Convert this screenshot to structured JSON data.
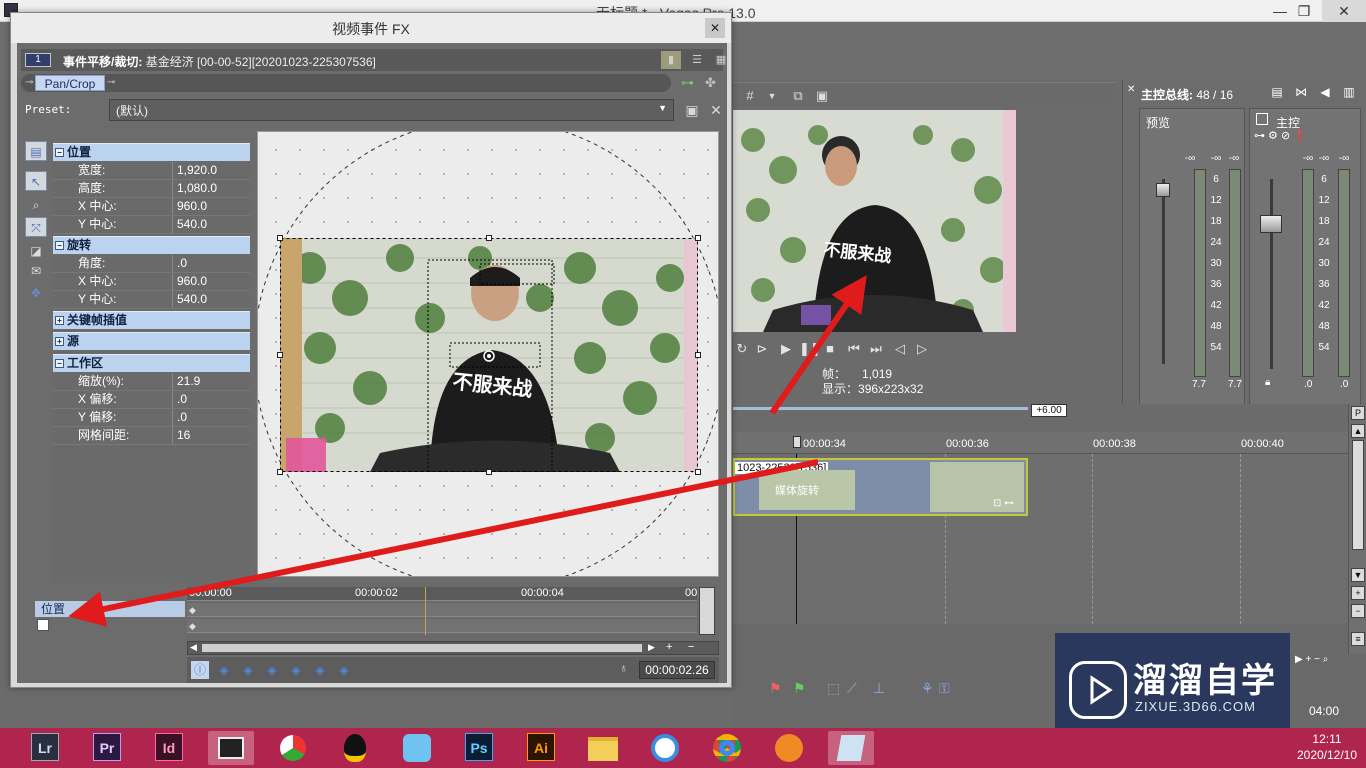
{
  "vegas": {
    "title": "无标题 * - Vegas Pro 13.0",
    "win_minimize": "—",
    "win_restore": "❐",
    "win_close": "✕",
    "preview": {
      "frame_label": "帧：",
      "frame_value": "1,019",
      "display_label": "显示：",
      "display_value": "396x223x32"
    },
    "master": {
      "title": "主控总线:",
      "count": "48 / 16",
      "preview_label": "预览",
      "main_label": "主控",
      "scale": [
        "-∞",
        "6",
        "12",
        "18",
        "24",
        "30",
        "36",
        "42",
        "48",
        "54"
      ],
      "preview_vals": [
        "7.7",
        "7.7"
      ],
      "main_vals": [
        ".0",
        ".0"
      ]
    },
    "timeline": {
      "rate_badge": "+6.00",
      "ticks": [
        "00:00:34",
        "00:00:36",
        "00:00:38",
        "00:00:40"
      ],
      "clip_name": "1023-22530[7536]",
      "clip_fx_label": "媒体旋转",
      "bottom_time": "04:00"
    }
  },
  "fx": {
    "title": "视频事件 FX",
    "close": "✕",
    "chain_badge": "1",
    "chain_title_bold": "事件平移/裁切:",
    "chain_title": "基金经济 [00-00-52][20201023-225307536]",
    "plugin_tab": "Pan/Crop",
    "preset_label": "Preset:",
    "preset_value": "(默认)",
    "sections": {
      "position": "位置",
      "rotation": "旋转",
      "keyframe_interp": "关键帧插值",
      "source": "源",
      "workspace": "工作区"
    },
    "props": {
      "width": {
        "name": "宽度:",
        "value": "1,920.0"
      },
      "height": {
        "name": "高度:",
        "value": "1,080.0"
      },
      "x_center": {
        "name": "X 中心:",
        "value": "960.0"
      },
      "y_center": {
        "name": "Y 中心:",
        "value": "540.0"
      },
      "angle": {
        "name": "角度:",
        "value": ".0"
      },
      "rot_x_center": {
        "name": "X 中心:",
        "value": "960.0"
      },
      "rot_y_center": {
        "name": "Y 中心:",
        "value": "540.0"
      },
      "zoom": {
        "name": "缩放(%):",
        "value": "21.9"
      },
      "x_offset": {
        "name": "X 偏移:",
        "value": ".0"
      },
      "y_offset": {
        "name": "Y 偏移:",
        "value": ".0"
      },
      "grid_spacing": {
        "name": "网格间距:",
        "value": "16"
      }
    },
    "image_text": "不服来战",
    "keyframes": {
      "row_label": "位置",
      "ticks": [
        "00:00:00",
        "00:00:02",
        "00:00:04",
        "00"
      ],
      "timecode": "00:00:02.26"
    }
  },
  "watermark": {
    "brand": "溜溜自学",
    "url": "ZIXUE.3D66.COM"
  },
  "taskbar": {
    "apps": [
      "Lr",
      "Pr",
      "Id",
      "Ps",
      "Ai"
    ],
    "time": "12:11",
    "date": "2020/12/10"
  },
  "colors": {
    "taskbar": "#b0254d",
    "arrow": "#e01b1b",
    "section_header": "#bcd3ef",
    "clip_border": "#c7c832"
  }
}
